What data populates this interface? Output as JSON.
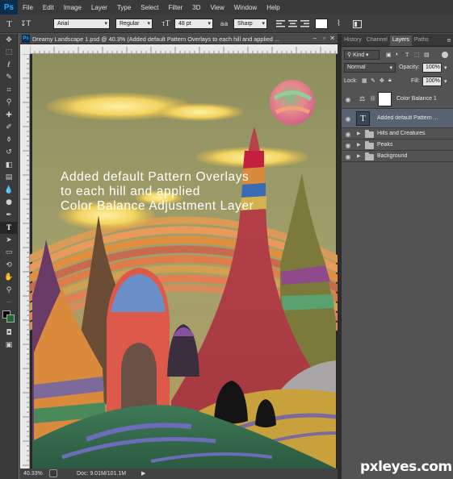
{
  "menu": {
    "logo": "Ps",
    "items": [
      "File",
      "Edit",
      "Image",
      "Layer",
      "Type",
      "Select",
      "Filter",
      "3D",
      "View",
      "Window",
      "Help"
    ]
  },
  "options": {
    "font_family": "Arial",
    "font_style": "Regular",
    "font_size": "48 pt",
    "anti_alias_label": "a",
    "anti_alias": "Sharp",
    "text_color": "#ffffff"
  },
  "document": {
    "tab_title": "Dreamy Landscape 1.psd @ 40.3% (Added default Pattern Overlays to each hill and applied ...",
    "annotation_lines": [
      "Added default Pattern Overlays",
      "to each hill and applied",
      "Color Balance Adjustment Layer"
    ],
    "zoom": "40.33%",
    "doc_size": "Doc: 9.01M/101.1M"
  },
  "panel": {
    "tabs": [
      "History",
      "Channel",
      "Layers",
      "Paths"
    ],
    "active_tab": "Layers",
    "filter_kind": "Kind",
    "blend_mode": "Normal",
    "opacity_label": "Opacity:",
    "opacity": "100%",
    "lock_label": "Lock:",
    "fill_label": "Fill:",
    "fill": "100%",
    "layers": [
      {
        "name": "Color Balance 1",
        "type": "adjustment",
        "selected": false
      },
      {
        "name": "Added default Pattern ...",
        "type": "text",
        "selected": true
      },
      {
        "name": "Hills and Creatures",
        "type": "group",
        "selected": false
      },
      {
        "name": "Peaks",
        "type": "group",
        "selected": false
      },
      {
        "name": "Background",
        "type": "group",
        "selected": false
      }
    ]
  },
  "watermark": "pxleyes.com",
  "colors": {
    "app_bg": "#535353",
    "selected_layer": "#596270",
    "sky": "#9a9a6a",
    "ps_blue": "#35a4ff"
  }
}
